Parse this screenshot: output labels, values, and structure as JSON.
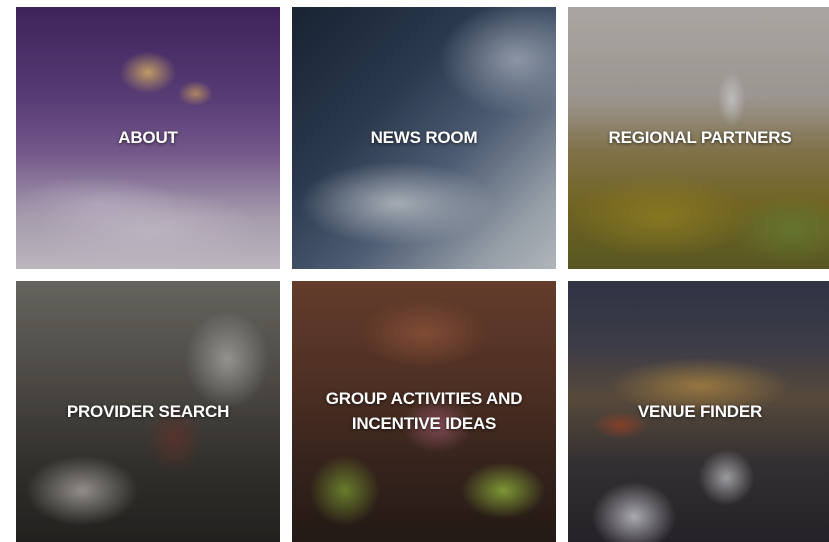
{
  "tiles": [
    {
      "label": "ABOUT"
    },
    {
      "label": "NEWS ROOM"
    },
    {
      "label": "REGIONAL PARTNERS"
    },
    {
      "label": "PROVIDER SEARCH"
    },
    {
      "label": "GROUP ACTIVITIES AND INCENTIVE IDEAS"
    },
    {
      "label": "VENUE FINDER"
    }
  ]
}
